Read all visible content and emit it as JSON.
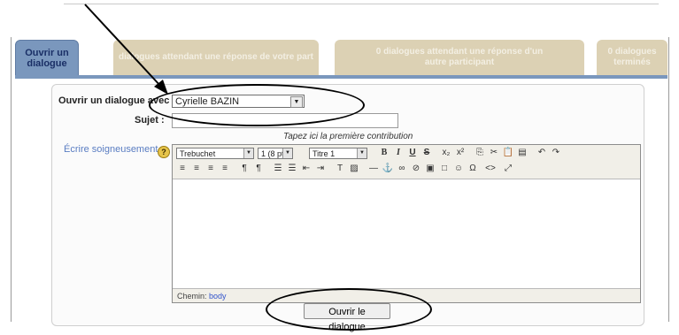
{
  "tabs": [
    {
      "label": "Ouvrir un dialogue",
      "active": true
    },
    {
      "label": "dialogues attendant une réponse de votre part",
      "active": false
    },
    {
      "label": "0 dialogues attendant une réponse d'un autre participant",
      "active": false
    },
    {
      "label": "0 dialogues terminés",
      "active": false
    }
  ],
  "form": {
    "recipient_label": "Ouvrir un dialogue avec :",
    "recipient_value": "Cyrielle BAZIN",
    "subject_label": "Sujet :",
    "subject_value": "",
    "subject_hint": "Tapez ici la première contribution",
    "write_label": "Écrire soigneusement",
    "help_icon": "?"
  },
  "editor": {
    "font_select": "Trebuchet",
    "size_select": "1 (8 pt)",
    "style_select": "Titre 1",
    "path_label": "Chemin:",
    "path_value": "body"
  },
  "submit_label": "Ouvrir le dialogue",
  "colors": {
    "active_tab": "#7a97bd",
    "inactive_tab": "#dcd1b4",
    "tab_text": "#1a2f66",
    "link": "#5a7dc2"
  }
}
